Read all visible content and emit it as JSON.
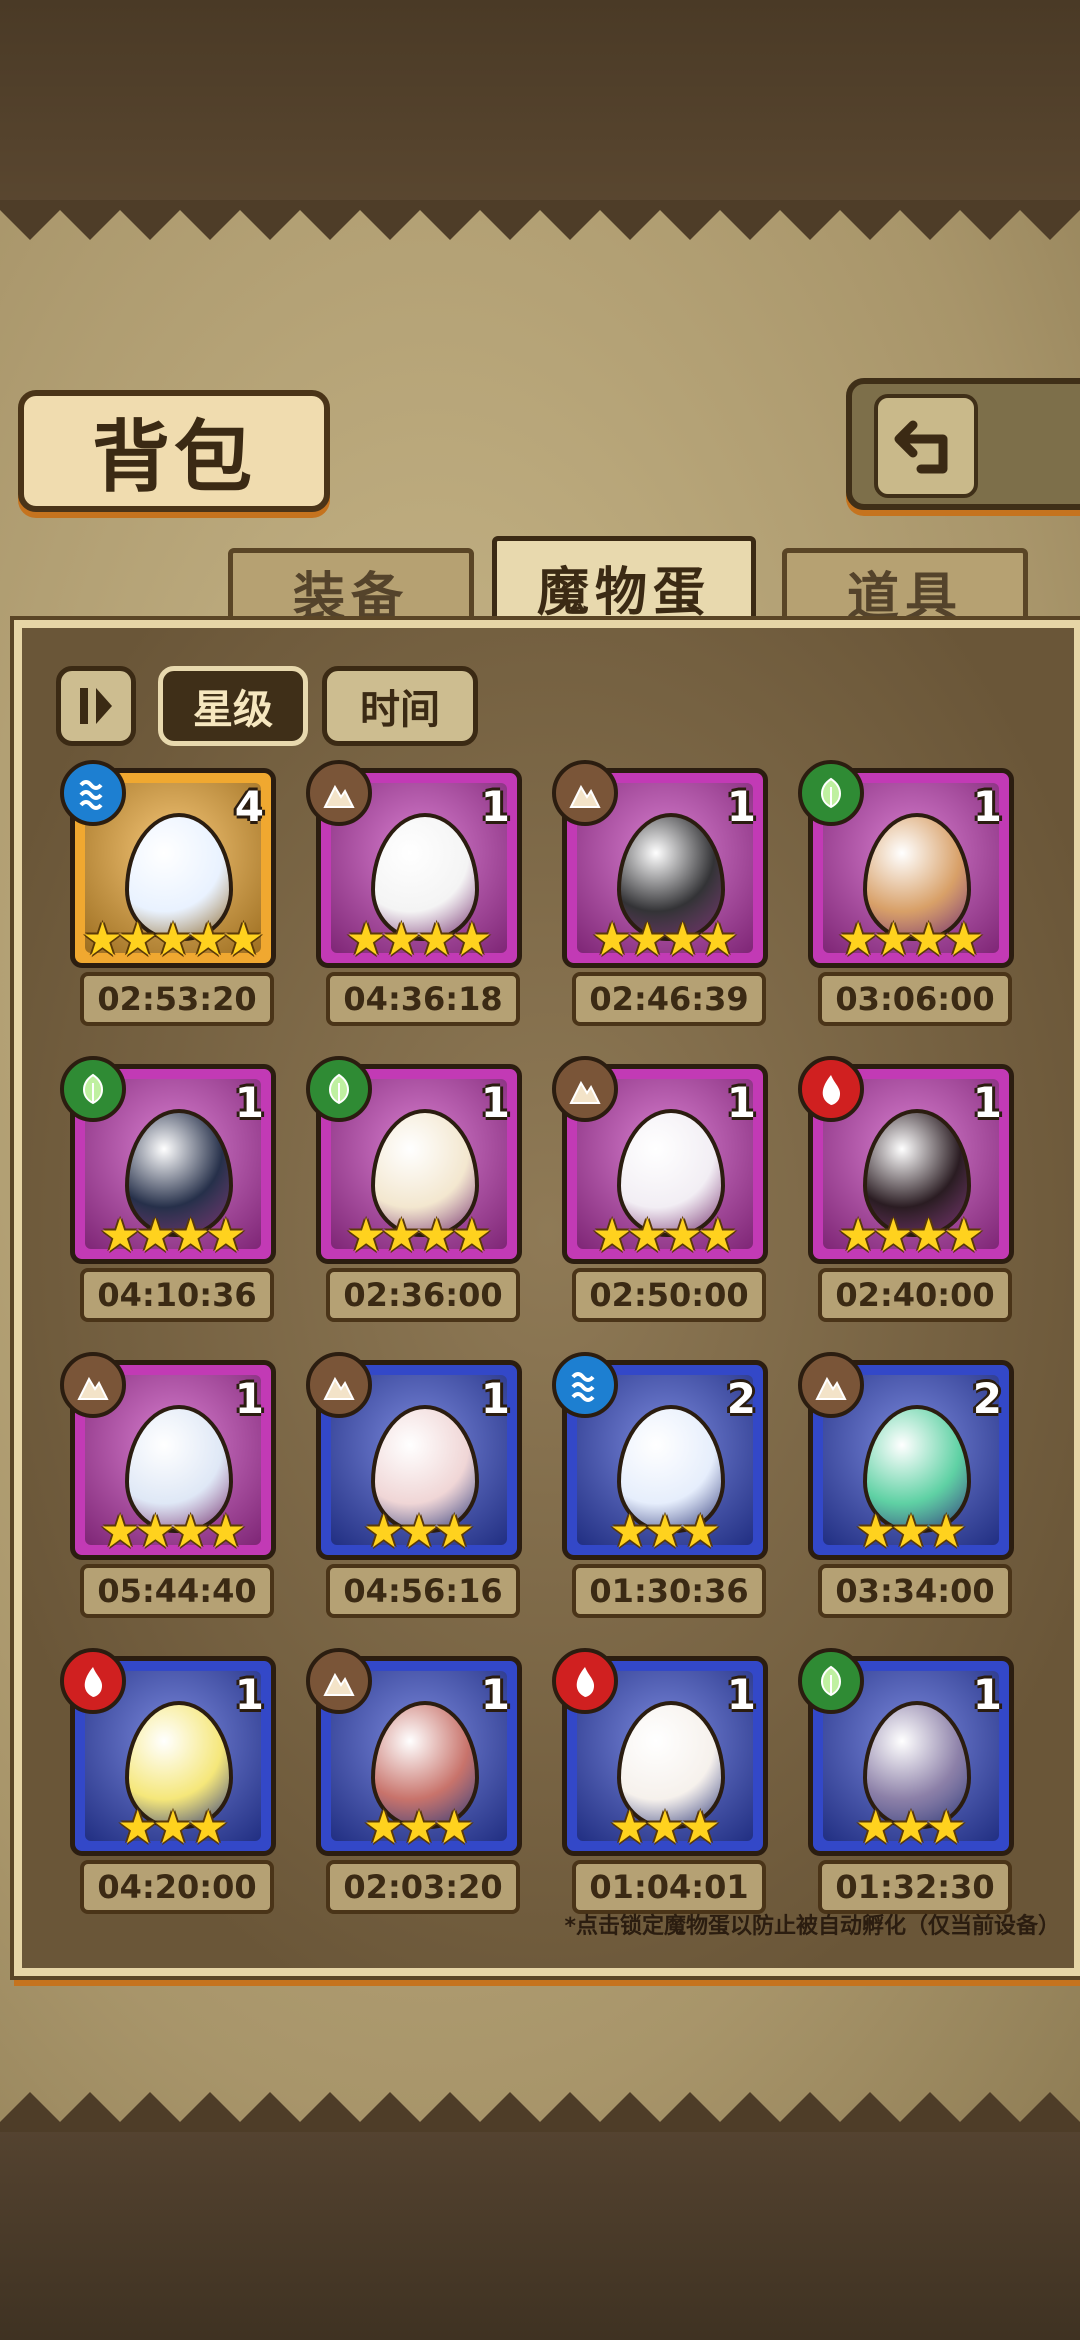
{
  "title": "背包",
  "tabs": [
    {
      "label": "装备",
      "active": false
    },
    {
      "label": "魔物蛋",
      "active": true
    },
    {
      "label": "道具",
      "active": false
    }
  ],
  "filters": {
    "sort_toggle_icon": "sort-toggle-icon",
    "star_label": "星级",
    "time_label": "时间"
  },
  "element_colors": {
    "water": "#1d7fd1",
    "earth": "#7a5538",
    "nature": "#2f8b34",
    "fire": "#d02020"
  },
  "rarity_colors": {
    "legendary": "#f0a830",
    "epic": "#c23ab5",
    "rare": "#3348c8"
  },
  "eggs": [
    {
      "element": "water",
      "count": "4",
      "stars": 5,
      "rarity": "legendary",
      "time": "02:53:20",
      "color": "#e9f2ff"
    },
    {
      "element": "earth",
      "count": "1",
      "stars": 4,
      "rarity": "epic",
      "time": "04:36:18",
      "color": "#f4f4f4"
    },
    {
      "element": "earth",
      "count": "1",
      "stars": 4,
      "rarity": "epic",
      "time": "02:46:39",
      "color": "#333336"
    },
    {
      "element": "nature",
      "count": "1",
      "stars": 4,
      "rarity": "epic",
      "time": "03:06:00",
      "color": "#d8a068"
    },
    {
      "element": "nature",
      "count": "1",
      "stars": 4,
      "rarity": "epic",
      "time": "04:10:36",
      "color": "#26304a"
    },
    {
      "element": "nature",
      "count": "1",
      "stars": 4,
      "rarity": "epic",
      "time": "02:36:00",
      "color": "#f3e7cf"
    },
    {
      "element": "earth",
      "count": "1",
      "stars": 4,
      "rarity": "epic",
      "time": "02:50:00",
      "color": "#f2eef4"
    },
    {
      "element": "fire",
      "count": "1",
      "stars": 4,
      "rarity": "epic",
      "time": "02:40:00",
      "color": "#2a1c22"
    },
    {
      "element": "earth",
      "count": "1",
      "stars": 4,
      "rarity": "epic",
      "time": "05:44:40",
      "color": "#dfe8f6"
    },
    {
      "element": "earth",
      "count": "1",
      "stars": 3,
      "rarity": "rare",
      "time": "04:56:16",
      "color": "#f0d6d6"
    },
    {
      "element": "water",
      "count": "2",
      "stars": 3,
      "rarity": "rare",
      "time": "01:30:36",
      "color": "#e6eefc"
    },
    {
      "element": "earth",
      "count": "2",
      "stars": 3,
      "rarity": "rare",
      "time": "03:34:00",
      "color": "#5fd1a4"
    },
    {
      "element": "fire",
      "count": "1",
      "stars": 3,
      "rarity": "rare",
      "time": "04:20:00",
      "color": "#f5e77a"
    },
    {
      "element": "earth",
      "count": "1",
      "stars": 3,
      "rarity": "rare",
      "time": "02:03:20",
      "color": "#c8736b"
    },
    {
      "element": "fire",
      "count": "1",
      "stars": 3,
      "rarity": "rare",
      "time": "01:04:01",
      "color": "#f6f1ec"
    },
    {
      "element": "nature",
      "count": "1",
      "stars": 3,
      "rarity": "rare",
      "time": "01:32:30",
      "color": "#8c80a8"
    }
  ],
  "footnote": "*点击锁定魔物蛋以防止被自动孵化（仅当前设备）"
}
